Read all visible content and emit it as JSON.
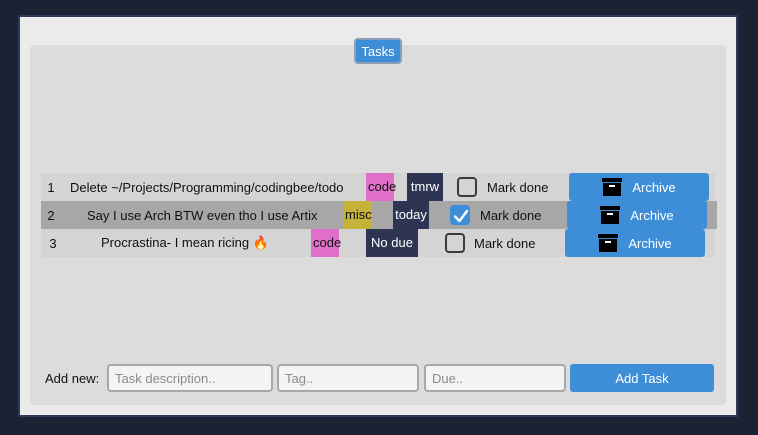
{
  "tab": {
    "label": "Tasks"
  },
  "tasks": [
    {
      "num": "1",
      "description": "Delete ~/Projects/Programming/codingbee/todo",
      "tag": "code",
      "due": "tmrw",
      "mark_label": "Mark done",
      "done": false,
      "archive_label": "Archive"
    },
    {
      "num": "2",
      "description": "Say I use Arch BTW even tho I use Artix",
      "tag": "misc",
      "due": "today",
      "mark_label": "Mark done",
      "done": true,
      "archive_label": "Archive"
    },
    {
      "num": "3",
      "description": "Procrastina- I mean ricing 🔥",
      "tag": "code",
      "due": "No due",
      "mark_label": "Mark done",
      "done": false,
      "archive_label": "Archive"
    }
  ],
  "add_new": {
    "label": "Add new:",
    "description_placeholder": "Task description..",
    "tag_placeholder": "Tag..",
    "due_placeholder": "Due..",
    "button_label": "Add Task"
  },
  "colors": {
    "accent": "#3d8ed6",
    "tag_code": "#e06fc9",
    "tag_misc": "#c4b338",
    "due_bg": "#2e3552",
    "background": "#1b2233"
  },
  "icons": {
    "archive": "archive-box-icon",
    "check": "checkmark-icon"
  }
}
